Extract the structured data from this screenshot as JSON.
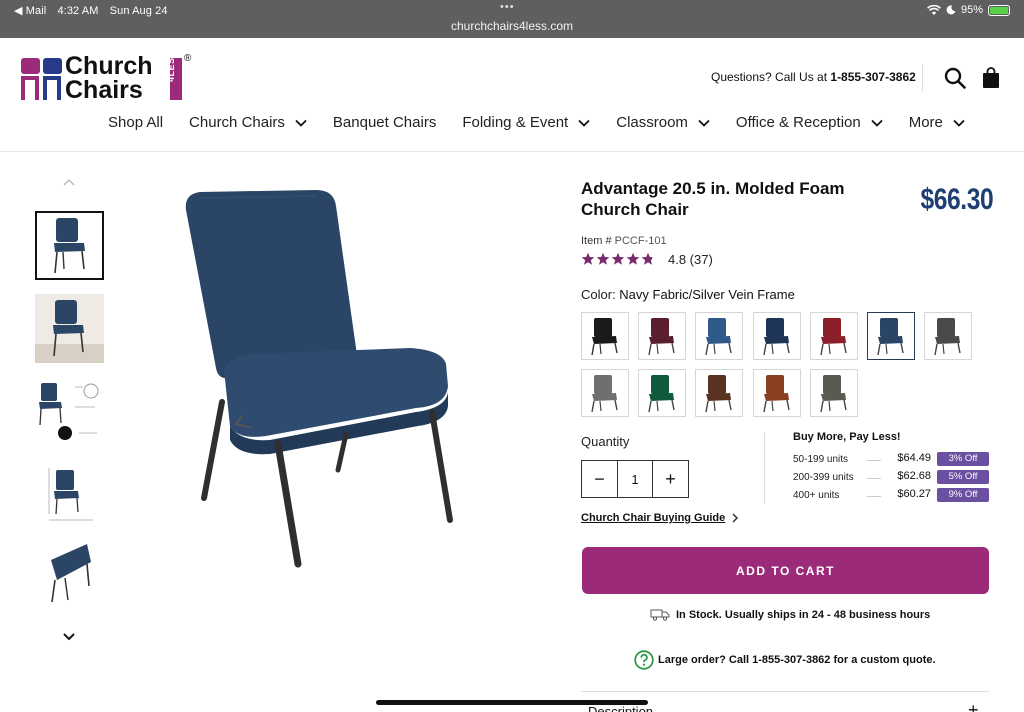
{
  "status_bar": {
    "back_app": "◀ Mail",
    "time": "4:32 AM",
    "date": "Sun Aug 24",
    "url": "churchchairs4less.com",
    "battery": "95%"
  },
  "header": {
    "logo_text_line1": "Church",
    "logo_text_line2": "Chairs",
    "logo_badge": "4LESS",
    "logo_reg": "®",
    "questions_prefix": "Questions? Call Us at ",
    "phone": "1-855-307-3862"
  },
  "nav": {
    "items": [
      {
        "label": "Shop All",
        "has_dropdown": false
      },
      {
        "label": "Church Chairs",
        "has_dropdown": true
      },
      {
        "label": "Banquet Chairs",
        "has_dropdown": false
      },
      {
        "label": "Folding & Event",
        "has_dropdown": true
      },
      {
        "label": "Classroom",
        "has_dropdown": true
      },
      {
        "label": "Office & Reception",
        "has_dropdown": true
      },
      {
        "label": "More",
        "has_dropdown": true
      }
    ]
  },
  "product": {
    "title": "Advantage 20.5 in. Molded Foam Church Chair",
    "price": "$66.30",
    "item_label": "Item #",
    "item_number": "PCCF-101",
    "rating_stars": 4.8,
    "rating_text": "4.8 (37)",
    "color_label": "Color: ",
    "color_value": "Navy Fabric/Silver Vein Frame",
    "swatches": [
      {
        "color": "#1a1a1a",
        "frame": "#333"
      },
      {
        "color": "#5a1f2e",
        "frame": "#444"
      },
      {
        "color": "#2f5a8a",
        "frame": "#444"
      },
      {
        "color": "#1e3557",
        "frame": "#444"
      },
      {
        "color": "#8a1f2a",
        "frame": "#444"
      },
      {
        "color": "#2b4566",
        "frame": "#444",
        "selected": true
      },
      {
        "color": "#4a4a4a",
        "frame": "#444"
      },
      {
        "color": "#6f6f6f",
        "frame": "#444"
      },
      {
        "color": "#0f5a3a",
        "frame": "#444"
      },
      {
        "color": "#5a3222",
        "frame": "#444"
      },
      {
        "color": "#8a3e22",
        "frame": "#444"
      },
      {
        "color": "#5a5a52",
        "frame": "#444"
      }
    ],
    "quantity_label": "Quantity",
    "quantity_value": "1",
    "minus": "−",
    "plus": "+",
    "buy_more_title": "Buy More, Pay Less!",
    "tiers": [
      {
        "units": "50-199 units",
        "price": "$64.49",
        "off": "3% Off"
      },
      {
        "units": "200-399 units",
        "price": "$62.68",
        "off": "5% Off"
      },
      {
        "units": "400+ units",
        "price": "$60.27",
        "off": "9% Off"
      }
    ],
    "guide_link": "Church Chair Buying Guide",
    "add_to_cart": "ADD TO CART",
    "stock_text": "In Stock. Usually ships in 24 - 48 business hours",
    "large_order_text": "Large order? Call 1-855-307-3862 for a custom quote.",
    "description_label": "Description",
    "description_toggle": "+"
  },
  "colors": {
    "brand_magenta": "#9b2a78",
    "price_blue": "#1f3f73",
    "discount_purple": "#6b4fa0",
    "star_purple": "#7a2a6e",
    "status_bar": "#5f5f62"
  }
}
